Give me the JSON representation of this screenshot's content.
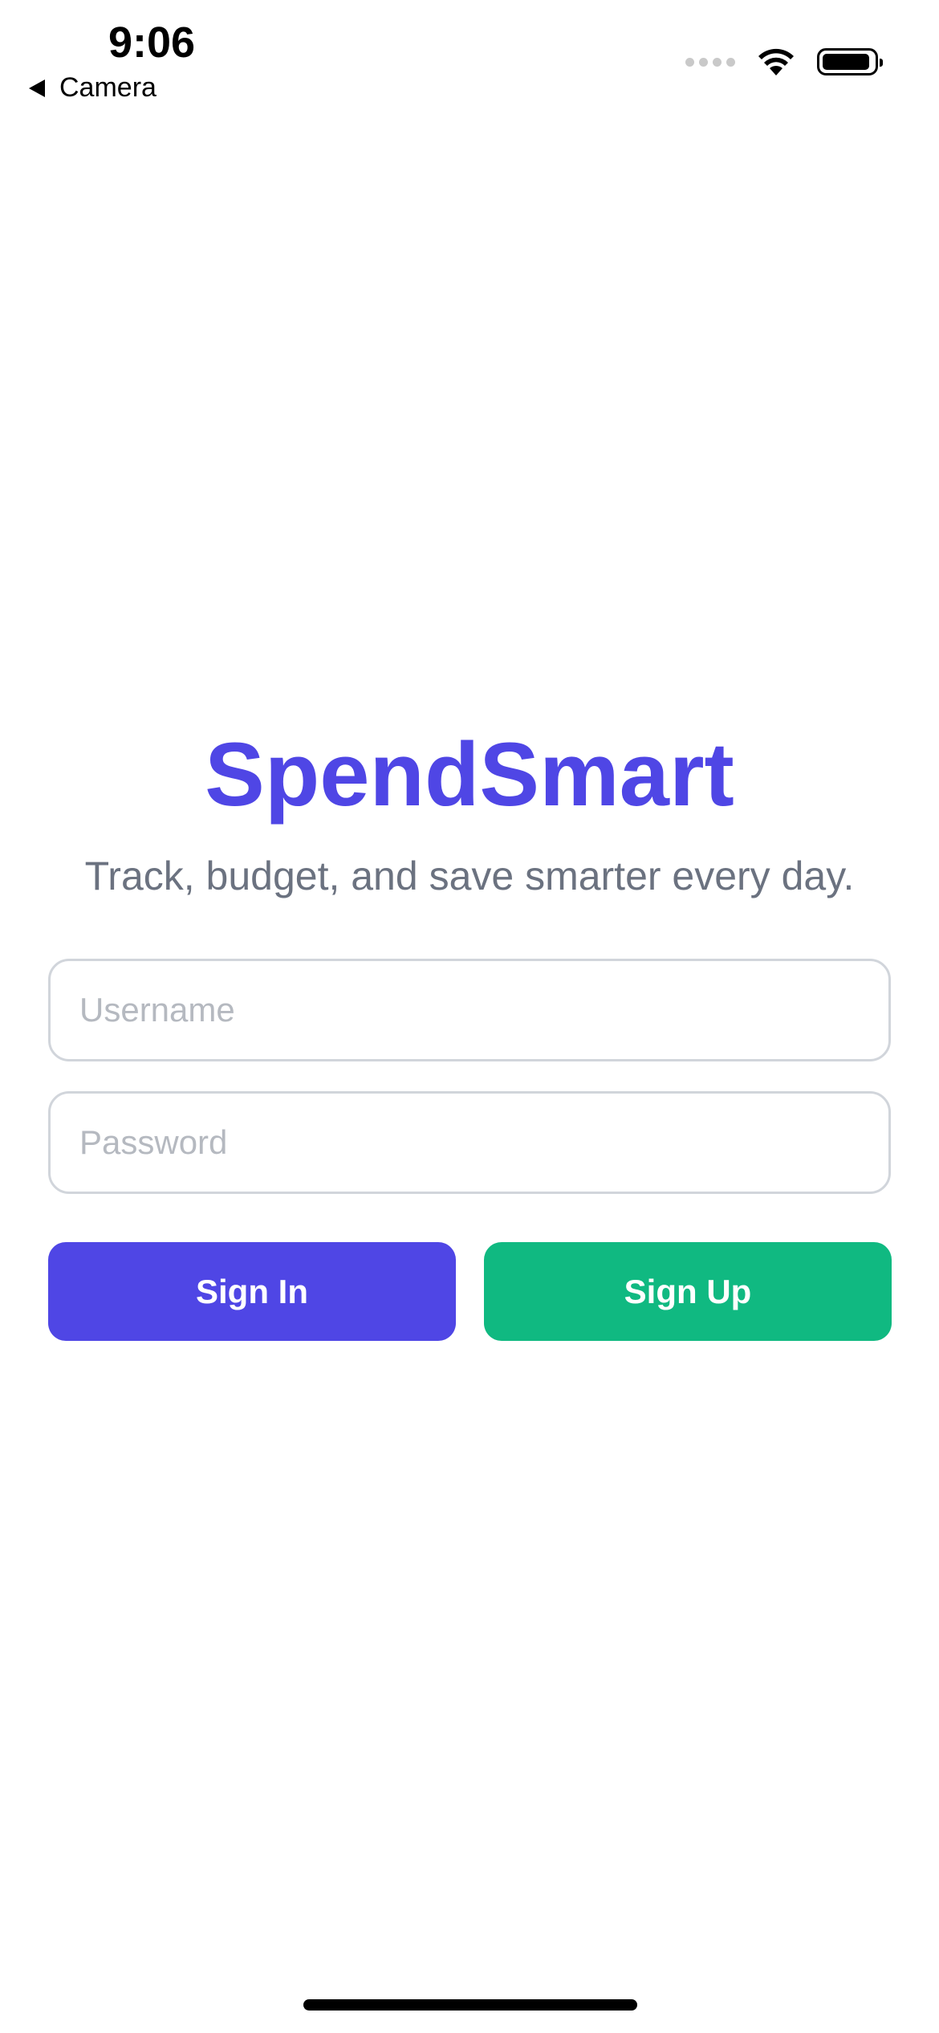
{
  "status_bar": {
    "time": "9:06",
    "back_label": "Camera",
    "icons": [
      "signal-dots-icon",
      "wifi-icon",
      "battery-icon"
    ]
  },
  "app": {
    "title": "SpendSmart",
    "tagline": "Track, budget, and save smarter every day.",
    "colors": {
      "brand": "#4f46e5",
      "tagline": "#6b7280",
      "sign_in": "#4f46e5",
      "sign_up": "#10b981",
      "field_border": "#d1d5db"
    }
  },
  "form": {
    "username": {
      "value": "",
      "placeholder": "Username"
    },
    "password": {
      "value": "",
      "placeholder": "Password"
    },
    "sign_in_label": "Sign In",
    "sign_up_label": "Sign Up"
  }
}
